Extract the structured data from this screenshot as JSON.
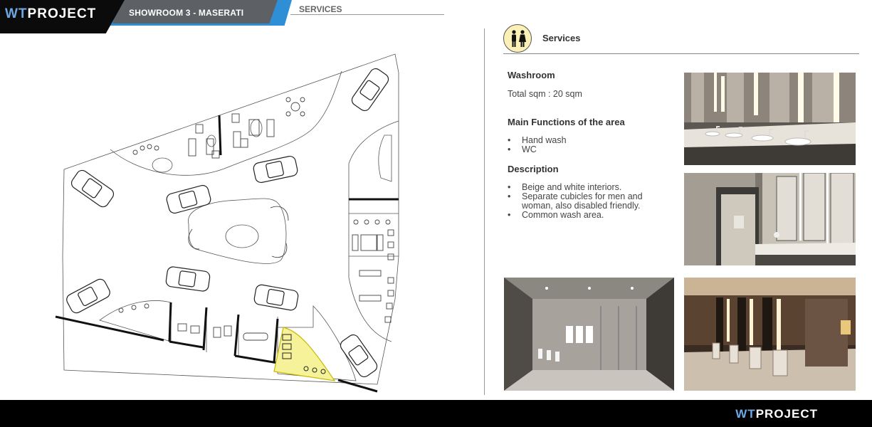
{
  "header": {
    "logo_wt": "WT",
    "logo_project": "PROJECT",
    "title": "SHOWROOM 3  -  MASERATI",
    "section": "SERVICES"
  },
  "services": {
    "heading": "Services",
    "icon": "restroom-icon"
  },
  "washroom": {
    "heading": "Washroom",
    "total_label": "Total sqm",
    "total_value": ": 20 sqm"
  },
  "main_functions": {
    "heading": "Main Functions of the area",
    "items": [
      "Hand wash",
      "WC"
    ]
  },
  "description": {
    "heading": "Description",
    "items": [
      "Beige and white interiors.",
      "Separate cubicles for men and woman, also disabled friendly.",
      "Common wash area."
    ]
  },
  "footer": {
    "logo_wt": "WT",
    "logo_project": "PROJECT"
  },
  "colors": {
    "accent_blue": "#2e8fd6",
    "header_gray": "#5d6165",
    "icon_bg": "#fbf0b6",
    "highlight_yellow": "#f6f29a"
  }
}
